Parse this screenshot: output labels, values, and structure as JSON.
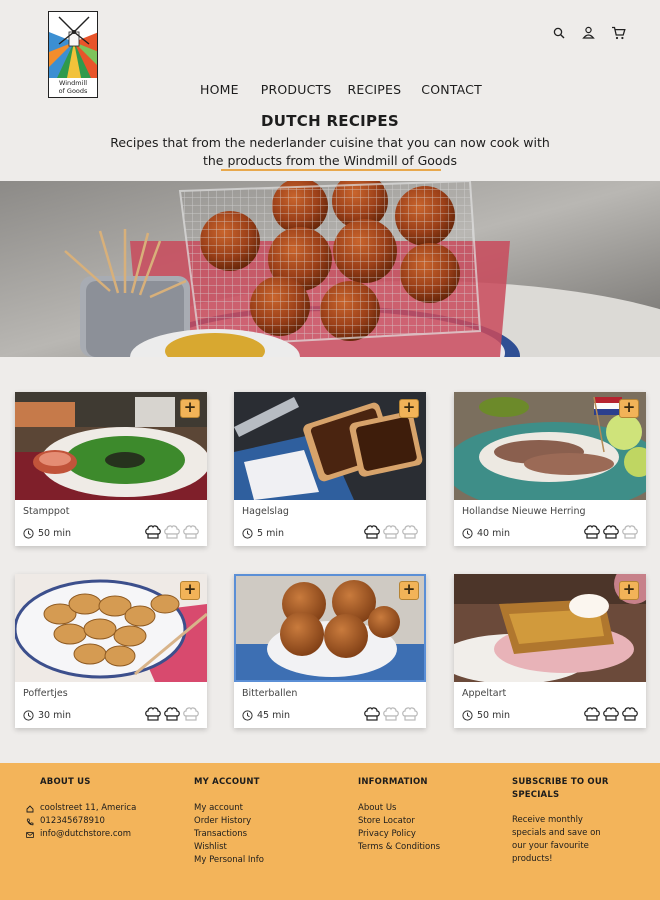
{
  "brand": {
    "logo_text_line1": "Windmill",
    "logo_text_line2": "of Goods"
  },
  "header_icons": [
    "search-icon",
    "user-icon",
    "cart-icon"
  ],
  "nav": {
    "home": "HOME",
    "products": "PRODUCTS",
    "recipes": "RECIPES",
    "contact": "CONTACT"
  },
  "page": {
    "title": "DUTCH RECIPES",
    "intro_line1": "Recipes that from the nederlander cuisine that you can now cook with",
    "intro_line2": "the products from the Windmill of Goods"
  },
  "recipes": [
    {
      "title": "Stamppot",
      "time": "50 min",
      "difficulty": 1
    },
    {
      "title": "Hagelslag",
      "time": "5 min",
      "difficulty": 1
    },
    {
      "title": "Hollandse Nieuwe Herring",
      "time": "40 min",
      "difficulty": 2
    },
    {
      "title": "Poffertjes",
      "time": "30 min",
      "difficulty": 2
    },
    {
      "title": "Bitterballen",
      "time": "45 min",
      "difficulty": 1
    },
    {
      "title": "Appeltart",
      "time": "50 min",
      "difficulty": 3
    }
  ],
  "add_label": "+",
  "footer": {
    "about": {
      "heading": "ABOUT US",
      "address": "coolstreet 11, America",
      "phone": "012345678910",
      "email": "info@dutchstore.com"
    },
    "account": {
      "heading": "MY ACCOUNT",
      "links": [
        "My account",
        "Order History",
        "Transactions",
        "Wishlist",
        "My Personal Info"
      ]
    },
    "information": {
      "heading": "INFORMATION",
      "links": [
        "About Us",
        "Store Locator",
        "Privacy Policy",
        "Terms & Conditions"
      ]
    },
    "subscribe": {
      "heading_line1": "SUBSCRIBE TO OUR",
      "heading_line2": "SPECIALS",
      "text": "Receive monthly specials and save on our your favourite products!"
    }
  },
  "colors": {
    "accent": "#f3b45a",
    "background": "#eeecea",
    "selected_outline": "#5b8fd6"
  }
}
